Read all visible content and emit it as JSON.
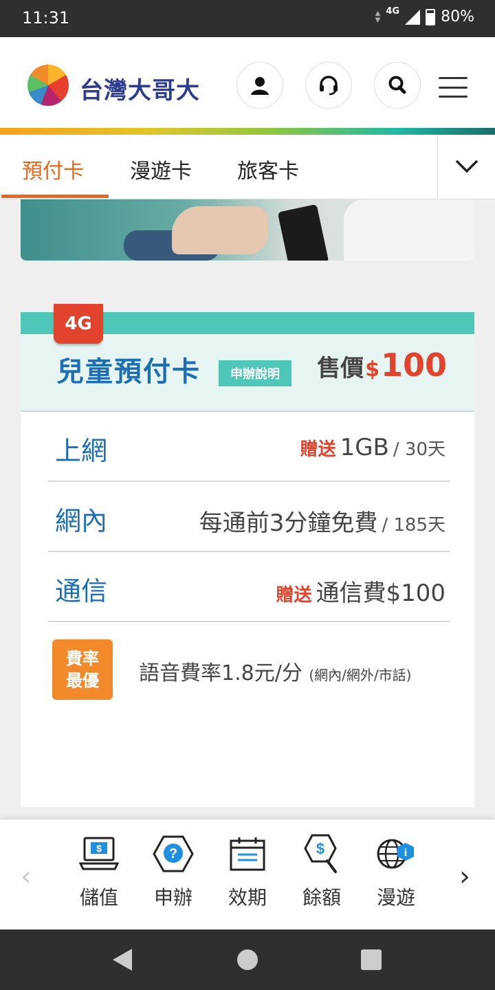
{
  "status": {
    "time": "11:31",
    "network": "4G",
    "battery": "80%"
  },
  "header": {
    "brand": "台灣大哥大",
    "icons": [
      "user-icon",
      "headset-icon",
      "search-icon",
      "menu-icon"
    ],
    "colors": {
      "brand_blue": "#2e3c8f",
      "accent_orange": "#e7671b"
    }
  },
  "tabs": {
    "items": [
      {
        "label": "預付卡",
        "active": true
      },
      {
        "label": "漫遊卡",
        "active": false
      },
      {
        "label": "旅客卡",
        "active": false
      }
    ]
  },
  "card": {
    "badge": "4G",
    "title": "兒童預付卡",
    "apply_label": "申辦說明",
    "price_label": "售價",
    "price_currency": "$",
    "price_value": "100",
    "rows": [
      {
        "label": "上網",
        "gift": "贈送",
        "value": "1GB",
        "suffix": "/ 30天"
      },
      {
        "label": "網內",
        "gift": "",
        "value": "每通前3分鐘免費",
        "suffix": "/ 185天"
      },
      {
        "label": "通信",
        "gift": "贈送",
        "value": "通信費$100",
        "suffix": ""
      }
    ],
    "rate_badge_line1": "費率",
    "rate_badge_line2": "最優",
    "rate_text": "語音費率1.8元/分",
    "rate_note": "(網內/網外/市話)"
  },
  "quickmenu": {
    "items": [
      {
        "label": "儲值",
        "icon": "laptop-dollar-icon"
      },
      {
        "label": "申辦",
        "icon": "question-hexagon-icon"
      },
      {
        "label": "效期",
        "icon": "calendar-icon"
      },
      {
        "label": "餘額",
        "icon": "balance-search-icon"
      },
      {
        "label": "漫遊",
        "icon": "globe-info-icon"
      }
    ],
    "prev_glyph": "‹",
    "next_glyph": "›"
  }
}
